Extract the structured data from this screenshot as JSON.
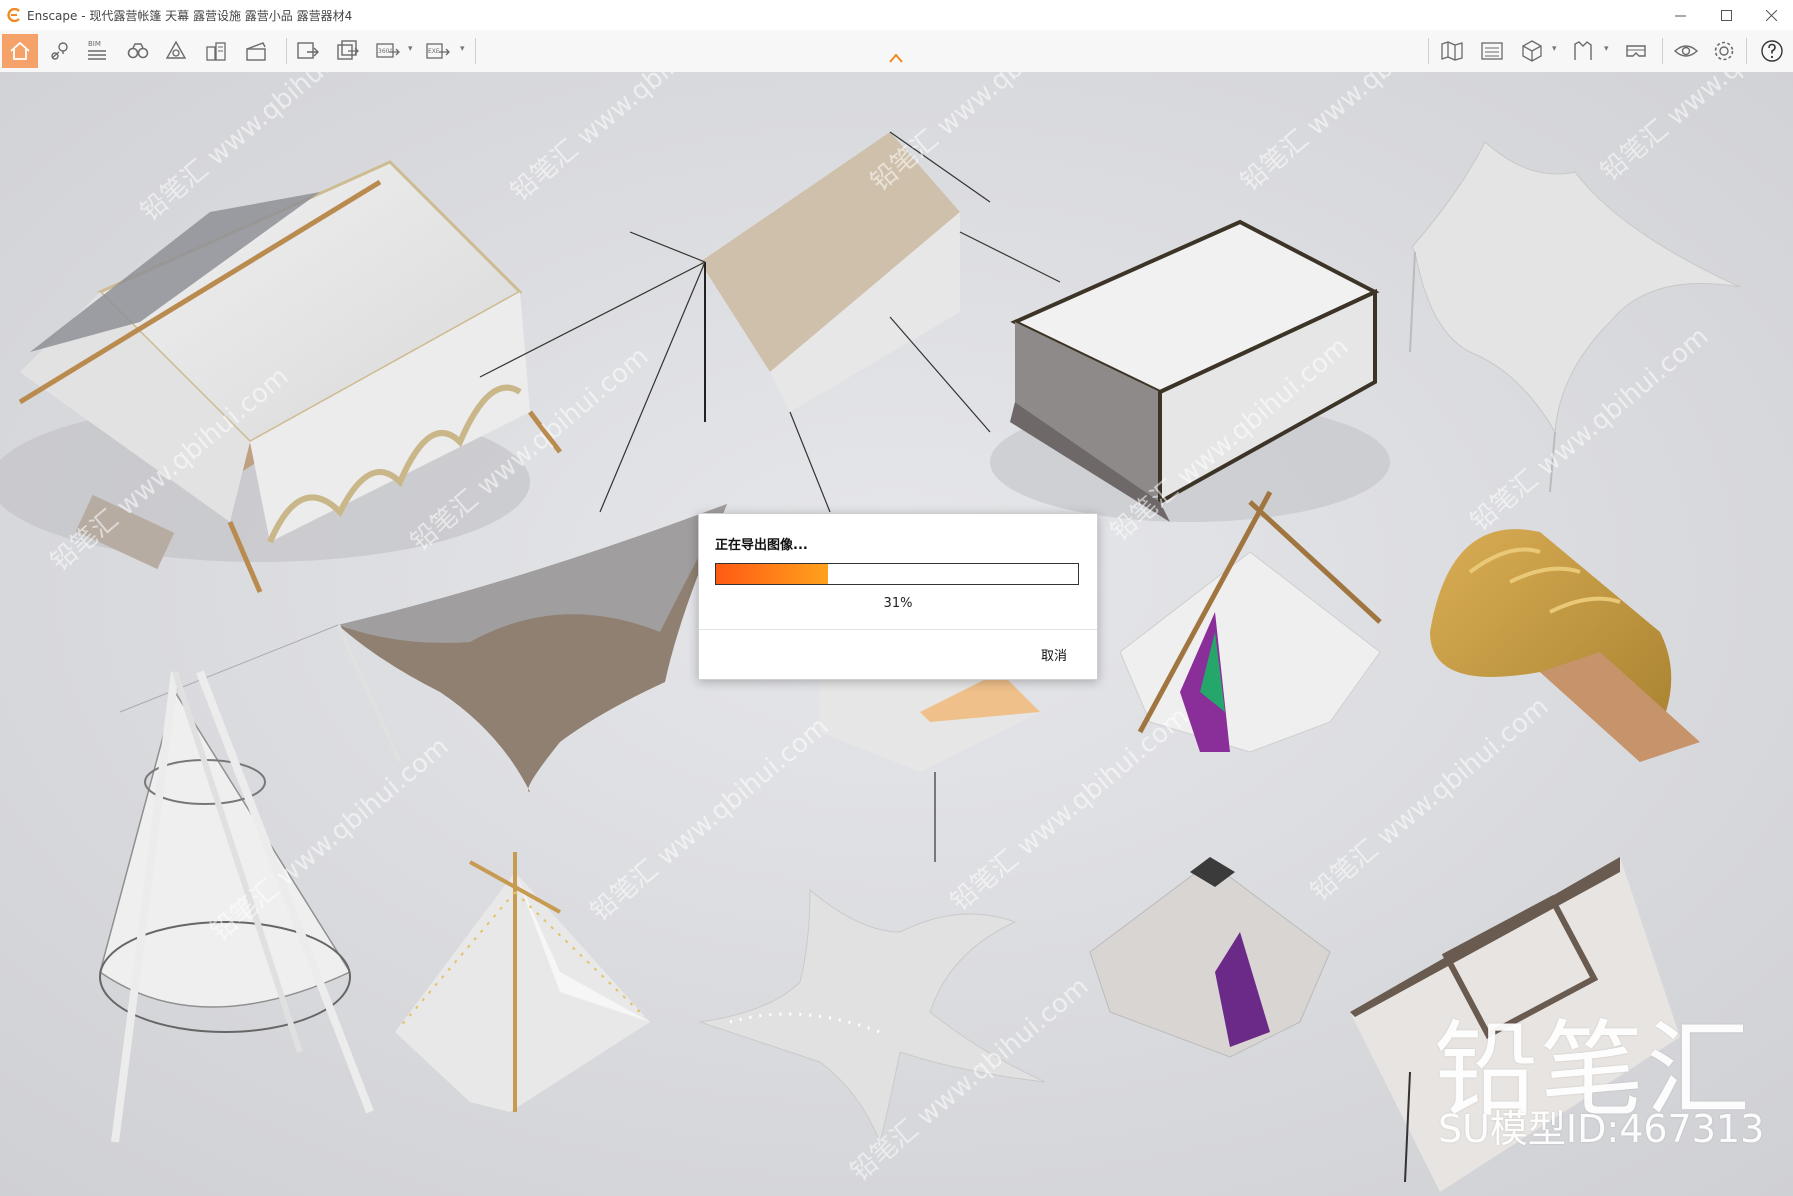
{
  "window": {
    "title": "Enscape - 现代露营帐篷 天幕 露营设施 露营小品 露营器材4",
    "accent": "#f5a26a"
  },
  "toolbar": {
    "bim_label": "BIM",
    "pano_label": "360°",
    "exe_label": "EXE",
    "left_icons": [
      "home-icon",
      "location-pin-icon",
      "bim-list-icon",
      "binoculars-icon",
      "orbit-icon",
      "buildings-icon",
      "clapper-icon",
      "screenshot-icon",
      "batch-render-icon",
      "panorama-icon",
      "export-exe-icon"
    ],
    "right_icons": [
      "map-icon",
      "layers-icon",
      "cube-icon",
      "asset-library-icon",
      "vr-headset-icon",
      "visibility-icon",
      "settings-icon",
      "help-icon"
    ]
  },
  "dialog": {
    "title": "正在导出图像...",
    "progress": 0.31,
    "progress_text": "31%",
    "cancel_label": "取消",
    "progress_color_start": "#ff5a14",
    "progress_color_end": "#ffa21c"
  },
  "watermark": {
    "brand": "铅笔汇",
    "model_id": "SU模型ID:467313",
    "tile_text": "铅笔汇 www.qbihui.com"
  }
}
